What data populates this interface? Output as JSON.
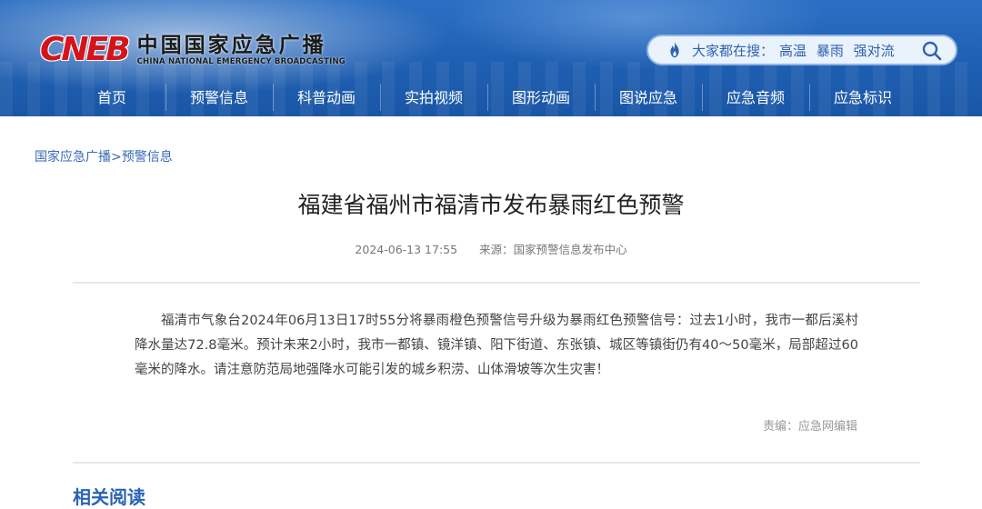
{
  "header": {
    "logo_mark": "CNEB",
    "logo_cn": "中国国家应急广播",
    "logo_en": "CHINA NATIONAL EMERGENCY BROADCASTING",
    "search": {
      "label": "大家都在搜：",
      "hot_terms": [
        "高温",
        "暴雨",
        "强对流"
      ],
      "icon": "flame-icon"
    }
  },
  "nav": {
    "items": [
      "首页",
      "预警信息",
      "科普动画",
      "实拍视频",
      "图形动画",
      "图说应急",
      "应急音频",
      "应急标识"
    ]
  },
  "breadcrumb": {
    "root": "国家应急广播",
    "separator": ">",
    "current": "预警信息"
  },
  "article": {
    "title": "福建省福州市福清市发布暴雨红色预警",
    "datetime": "2024-06-13 17:55",
    "source": "来源：国家预警信息发布中心",
    "body": "福清市气象台2024年06月13日17时55分将暴雨橙色预警信号升级为暴雨红色预警信号：过去1小时，我市一都后溪村降水量达72.8毫米。预计未来2小时，我市一都镇、镜洋镇、阳下街道、东张镇、城区等镇街仍有40～50毫米，局部超过60毫米的降水。请注意防范局地强降水可能引发的城乡积涝、山体滑坡等次生灾害！",
    "editor": "责编：应急网编辑"
  },
  "related": {
    "heading": "相关阅读"
  },
  "colors": {
    "header_blue": "#1f5fb2",
    "logo_red": "#d4141b",
    "link_blue": "#3869b8"
  }
}
